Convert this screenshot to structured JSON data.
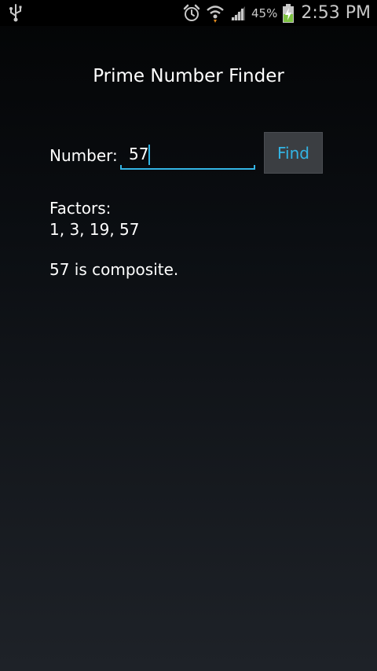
{
  "status_bar": {
    "icons": [
      "usb-icon",
      "alarm-icon",
      "wifi-icon",
      "signal-icon",
      "battery-charging-icon"
    ],
    "battery_percent": "45%",
    "time": "2:53 PM"
  },
  "app": {
    "title": "Prime Number Finder"
  },
  "form": {
    "number_label": "Number:",
    "number_value": "57",
    "find_label": "Find"
  },
  "results": {
    "factors_label": "Factors:",
    "factors": "1, 3, 19, 57",
    "verdict": "57 is composite."
  },
  "colors": {
    "accent": "#33b5e5",
    "background_top": "#030405",
    "background_bottom": "#1e2228",
    "battery_charge": "#7dc242"
  }
}
